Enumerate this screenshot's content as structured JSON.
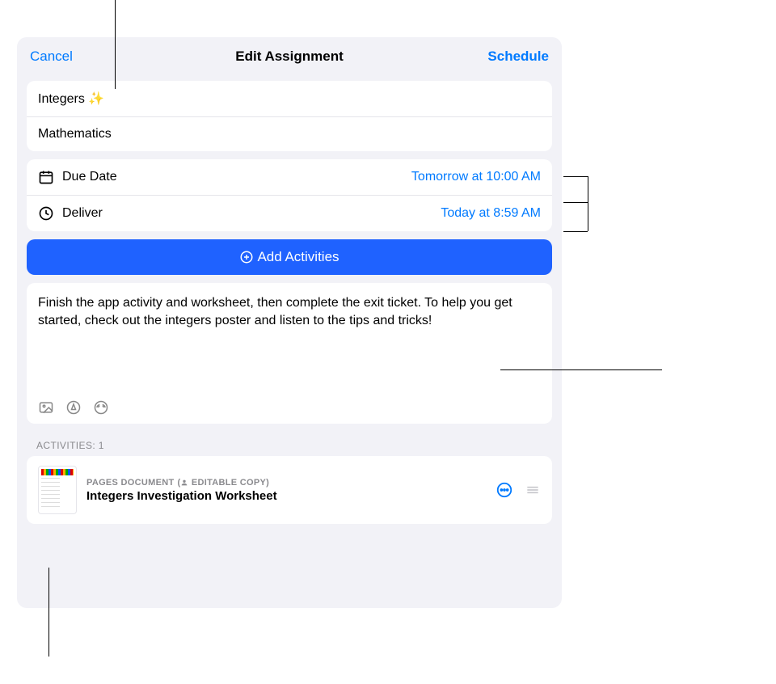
{
  "header": {
    "cancel": "Cancel",
    "title": "Edit Assignment",
    "schedule": "Schedule"
  },
  "assignment": {
    "name": "Integers ✨",
    "class": "Mathematics"
  },
  "dates": {
    "due_label": "Due Date",
    "due_value": "Tomorrow at 10:00 AM",
    "deliver_label": "Deliver",
    "deliver_value": "Today at 8:59 AM"
  },
  "add_activities_label": "Add Activities",
  "description": "Finish the app activity and worksheet, then complete the exit ticket. To help you get started, check out the integers poster and listen to the tips and tricks!",
  "activities_header": "ACTIVITIES: 1",
  "activity": {
    "type": "PAGES DOCUMENT",
    "copy_hint": "EDITABLE COPY",
    "title": "Integers Investigation Worksheet"
  }
}
